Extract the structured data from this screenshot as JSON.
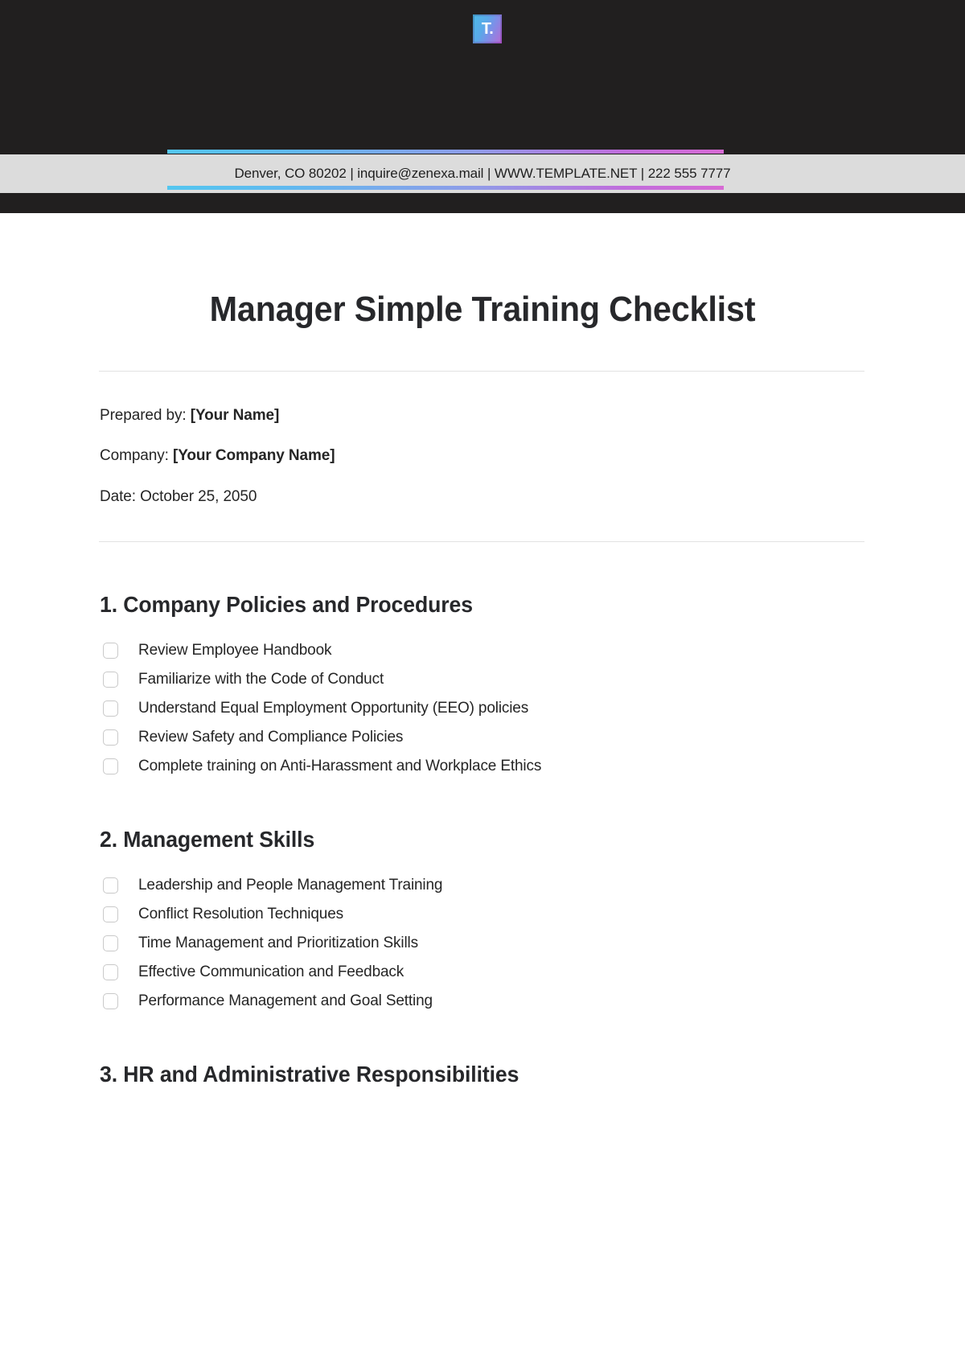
{
  "header": {
    "logo": {
      "icon": "template-net-logo-icon",
      "glyph": "T.",
      "gradient_from": "#4fb8e8",
      "gradient_to": "#b06fd6"
    },
    "background_color": "#211f1f"
  },
  "contact_bar": {
    "background_color": "#dcdcdc",
    "text": "Denver, CO 80202 | inquire@zenexa.mail | WWW.TEMPLATE.NET | 222 555 7777",
    "address": "Denver, CO 80202",
    "email": "inquire@zenexa.mail",
    "website": "WWW.TEMPLATE.NET",
    "phone": "222 555 7777",
    "accent_gradient": [
      "#54c6ef",
      "#8f9ce8",
      "#d76ad4"
    ]
  },
  "document": {
    "title": "Manager Simple Training Checklist",
    "meta": {
      "prepared_by_label": "Prepared by:",
      "prepared_by_value": "[Your Name]",
      "company_label": "Company:",
      "company_value": "[Your Company Name]",
      "date_line": "Date: October 25, 2050"
    },
    "sections": [
      {
        "heading": "1. Company Policies and Procedures",
        "items": [
          {
            "label": "Review Employee Handbook",
            "checked": false
          },
          {
            "label": "Familiarize with the Code of Conduct",
            "checked": false
          },
          {
            "label": "Understand Equal Employment Opportunity (EEO) policies",
            "checked": false
          },
          {
            "label": "Review Safety and Compliance Policies",
            "checked": false
          },
          {
            "label": "Complete training on Anti-Harassment and Workplace Ethics",
            "checked": false
          }
        ]
      },
      {
        "heading": "2. Management Skills",
        "items": [
          {
            "label": "Leadership and People Management Training",
            "checked": false
          },
          {
            "label": "Conflict Resolution Techniques",
            "checked": false
          },
          {
            "label": "Time Management and Prioritization Skills",
            "checked": false
          },
          {
            "label": "Effective Communication and Feedback",
            "checked": false
          },
          {
            "label": "Performance Management and Goal Setting",
            "checked": false
          }
        ]
      },
      {
        "heading": "3. HR and Administrative Responsibilities",
        "items": []
      }
    ]
  }
}
